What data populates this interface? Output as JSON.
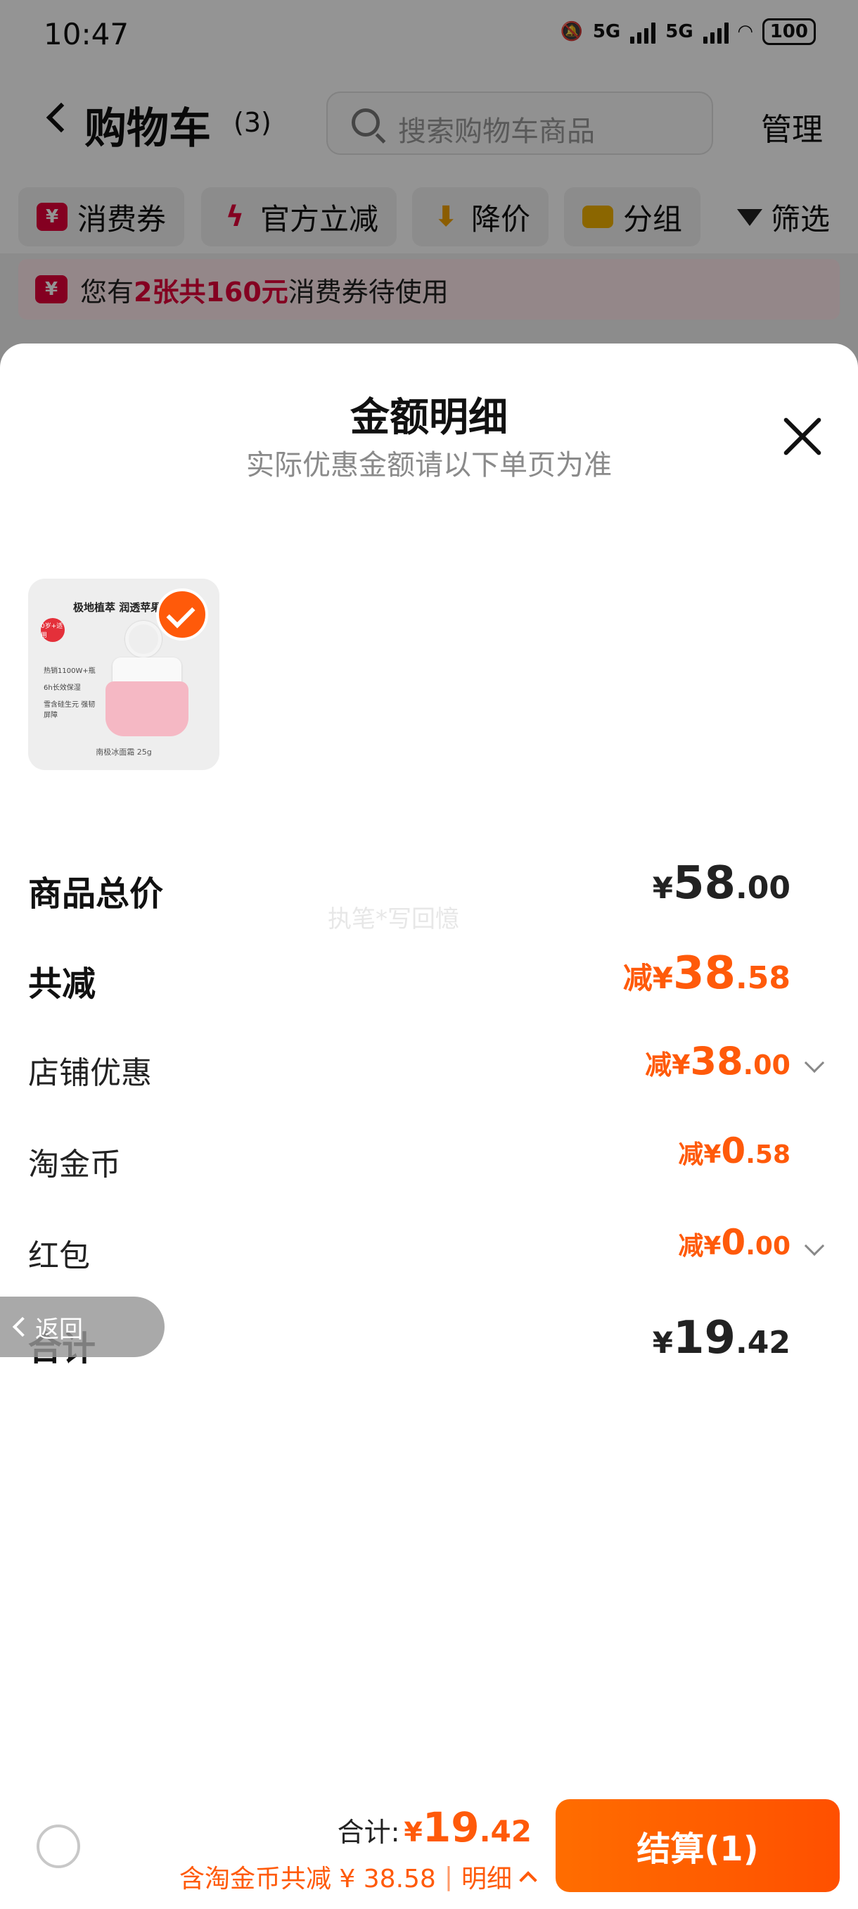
{
  "status_bar": {
    "time": "10:47",
    "network_1": "5G",
    "network_2": "5G",
    "battery": "100"
  },
  "cart_header": {
    "title": "购物车",
    "count": "(3)",
    "search_placeholder": "搜索购物车商品",
    "manage_label": "管理"
  },
  "filter_bar": {
    "chips": [
      {
        "label": "消费券",
        "icon": "coupon-icon",
        "color": "#e4003a"
      },
      {
        "label": "官方立减",
        "icon": "lightning-icon",
        "color": "#e4003a"
      },
      {
        "label": "降价",
        "icon": "price-down-icon",
        "color": "#f0a000"
      },
      {
        "label": "分组",
        "icon": "folder-icon",
        "color": "#f0b000"
      }
    ],
    "filter_label": "筛选"
  },
  "coupon_banner": {
    "prefix": "您有",
    "highlight": "2张共160元",
    "suffix": "消费券待使用"
  },
  "sheet": {
    "title": "金额明细",
    "subtitle": "实际优惠金额请以下单页为准",
    "product": {
      "headline": "极地植萃 润透苹果",
      "badge": "0岁+适用",
      "features": [
        "热销1100W+瓶",
        "6h长效保湿",
        "雪含硅生元 强韧屏障"
      ],
      "caption": "南极冰面霜 25g",
      "selected": true
    },
    "rows": {
      "goods_total": {
        "label": "商品总价",
        "currency": "¥",
        "int": "58",
        "dec": ".00"
      },
      "total_discount": {
        "label": "共减",
        "prefix": "减¥",
        "int": "38",
        "dec": ".58"
      },
      "store_discount": {
        "label": "店铺优惠",
        "prefix": "减¥",
        "int": "38",
        "dec": ".00"
      },
      "tao_coins": {
        "label": "淘金币",
        "prefix": "减¥",
        "int": "0",
        "dec": ".58"
      },
      "red_packet": {
        "label": "红包",
        "prefix": "减¥",
        "int": "0",
        "dec": ".00"
      },
      "total": {
        "label": "合计",
        "currency": "¥",
        "int": "19",
        "dec": ".42"
      }
    },
    "watermark": "执笔*写回憶",
    "back_label": "返回"
  },
  "checkout_bar": {
    "total_label": "合计:",
    "currency": "¥",
    "total_int": "19",
    "total_dec": ".42",
    "savings_text": "含淘金币共减 ¥ 38.58",
    "details_label": "明细",
    "checkout_label": "结算(1)"
  },
  "colors": {
    "accent_orange": "#ff5a0a",
    "coupon_red": "#e4003a"
  }
}
